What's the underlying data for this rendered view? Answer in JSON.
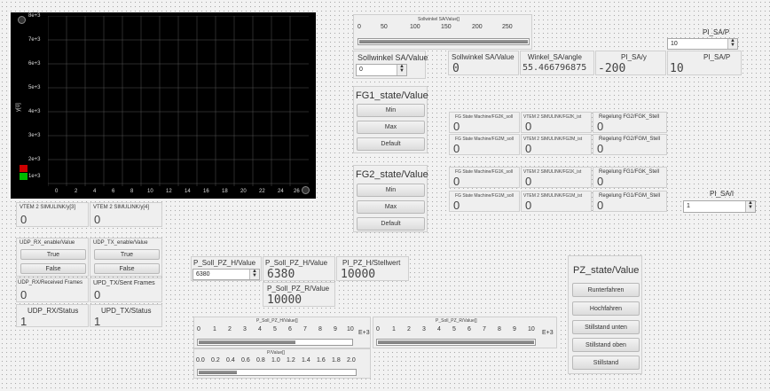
{
  "graph": {
    "y_label": "y[0]",
    "y_ticks": [
      "8e+3",
      "7e+3",
      "6e+3",
      "5e+3",
      "4e+3",
      "3e+3",
      "2e+3",
      "1e+3"
    ],
    "x_ticks": [
      "0",
      "2",
      "4",
      "6",
      "8",
      "10",
      "12",
      "14",
      "16",
      "18",
      "20",
      "22",
      "24",
      "26"
    ],
    "legend_colors": [
      "#cc0000",
      "#00bb00"
    ]
  },
  "vtem": {
    "y3_label": "VTEM 2 SIMULINK/y[3]",
    "y3_value": "0",
    "y4_label": "VTEM 2 SIMULINK/y[4]",
    "y4_value": "0"
  },
  "udp": {
    "rx_enable_label": "UDP_RX_enable/Value",
    "tx_enable_label": "UDP_TX_enable/Value",
    "rx_true": "True",
    "rx_false": "False",
    "tx_true": "True",
    "tx_false": "False",
    "rx_frames_label": "UDP_RX/Received Frames",
    "rx_frames_value": "0",
    "tx_frames_label": "UPD_TX/Sent Frames",
    "tx_frames_value": "0",
    "rx_status_label": "UDP_RX/Status",
    "rx_status_value": "1",
    "tx_status_label": "UPD_TX/Status",
    "tx_status_value": "1"
  },
  "sollwinkel_slider": {
    "title": "Sollwinkel SA/Value[]",
    "scale": [
      "0",
      "50",
      "100",
      "150",
      "200",
      "250"
    ],
    "level": 1.0
  },
  "sollwinkel_input": {
    "label": "Sollwinkel SA/Value",
    "value": "0"
  },
  "readouts": {
    "sollwinkel_label": "Sollwinkel SA/Value",
    "sollwinkel_value": "0",
    "winkel_label": "Winkel_SA/angle",
    "winkel_value": "55.466796875",
    "pisay_label": "PI_SA/y",
    "pisay_value": "-200",
    "pisap_label": "PI_SA/P",
    "pisap_value": "10"
  },
  "pi_sap_input": {
    "label": "PI_SA/P",
    "value": "10"
  },
  "pi_sai_input": {
    "label": "PI_SA/I",
    "value": "1"
  },
  "fg1": {
    "title": "FG1_state/Value",
    "buttons": [
      "Min",
      "Max",
      "Default"
    ],
    "r1_label": "FG State Machine/FG2K_soll",
    "r1_value": "0",
    "r2_label": "VTEM 2 SIMULINK/FG2K_ist",
    "r2_value": "0",
    "r3_label": "Regelung FG2/FGK_Stell",
    "r3_value": "0",
    "r4_label": "FG State Machine/FG2M_soll",
    "r4_value": "0",
    "r5_label": "VTEM 2 SIMULINK/FG2M_ist",
    "r5_value": "0",
    "r6_label": "Regelung FG2/FGM_Stell",
    "r6_value": "0"
  },
  "fg2": {
    "title": "FG2_state/Value",
    "buttons": [
      "Min",
      "Max",
      "Default"
    ],
    "r1_label": "FG State Machine/FG1K_soll",
    "r1_value": "0",
    "r2_label": "VTEM 2 SIMULINK/FG1K_ist",
    "r2_value": "0",
    "r3_label": "Regelung FG1/FGK_Stell",
    "r3_value": "0",
    "r4_label": "FG State Machine/FG1M_soll",
    "r4_value": "0",
    "r5_label": "VTEM 2 SIMULINK/FG1M_ist",
    "r5_value": "0",
    "r6_label": "Regelung FG1/FGM_Stell",
    "r6_value": "0"
  },
  "psoll": {
    "input_label": "P_Soll_PZ_H/Value",
    "input_value": "6380",
    "h_label": "P_Soll_PZ_H/Value",
    "h_value": "6380",
    "pi_label": "PI_PZ_H/Stellwert",
    "pi_value": "10000",
    "r_label": "P_Soll_PZ_R/Value",
    "r_value": "10000"
  },
  "slider_h": {
    "title": "P_Soll_PZ_H/Value[]",
    "scale": [
      "0",
      "1",
      "2",
      "3",
      "4",
      "5",
      "6",
      "7",
      "8",
      "9",
      "10"
    ],
    "unit": "E+3",
    "level": 0.638
  },
  "slider_r": {
    "title": "P_Soll_PZ_R/Value[]",
    "scale": [
      "0",
      "1",
      "2",
      "3",
      "4",
      "5",
      "6",
      "7",
      "8",
      "9",
      "10"
    ],
    "unit": "E+3",
    "level": 1.0
  },
  "slider_p": {
    "title": "P/Value[]",
    "scale": [
      "0.0",
      "0.2",
      "0.4",
      "0.6",
      "0.8",
      "1.0",
      "1.2",
      "1.4",
      "1.6",
      "1.8",
      "2.0"
    ],
    "level": 0.25
  },
  "pz": {
    "title": "PZ_state/Value",
    "buttons": [
      "Runterfahren",
      "Hochfahren",
      "Stillstand unten",
      "Stillstand oben",
      "Stillstand"
    ]
  }
}
